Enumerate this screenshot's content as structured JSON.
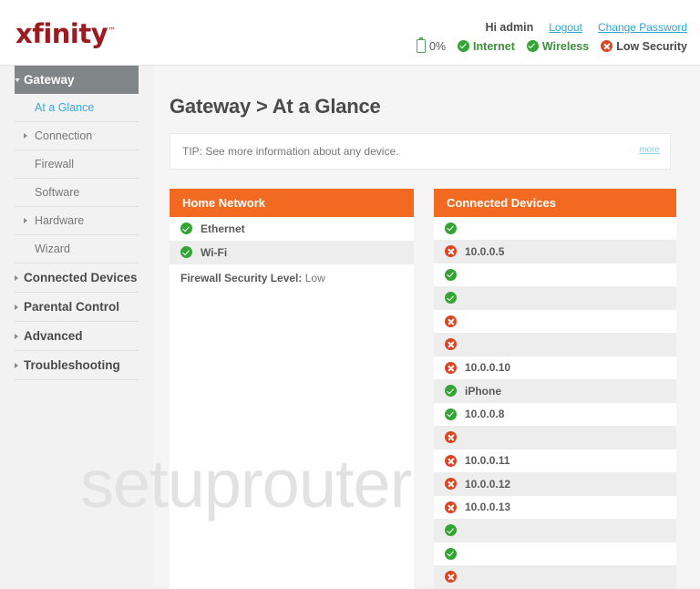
{
  "header": {
    "logo": "xfinity",
    "logo_tm": "™",
    "greeting": "Hi admin",
    "logout_label": "Logout",
    "change_password_label": "Change Password",
    "battery_percent": "0%",
    "statuses": [
      {
        "label": "Internet",
        "icon": "check-circle-icon",
        "state": "ok"
      },
      {
        "label": "Wireless",
        "icon": "check-circle-icon",
        "state": "ok"
      },
      {
        "label": "Low Security",
        "icon": "x-circle-icon",
        "state": "bad"
      }
    ]
  },
  "sidebar": {
    "items": [
      {
        "label": "Gateway",
        "type": "top",
        "caret": "down",
        "active": true
      },
      {
        "label": "At a Glance",
        "type": "sub",
        "caret": "none",
        "current": true
      },
      {
        "label": "Connection",
        "type": "sub",
        "caret": "right"
      },
      {
        "label": "Firewall",
        "type": "sub",
        "caret": "none"
      },
      {
        "label": "Software",
        "type": "sub",
        "caret": "none"
      },
      {
        "label": "Hardware",
        "type": "sub",
        "caret": "right"
      },
      {
        "label": "Wizard",
        "type": "sub",
        "caret": "none"
      },
      {
        "label": "Connected Devices",
        "type": "top",
        "caret": "right"
      },
      {
        "label": "Parental Control",
        "type": "top",
        "caret": "right"
      },
      {
        "label": "Advanced",
        "type": "top",
        "caret": "right"
      },
      {
        "label": "Troubleshooting",
        "type": "top",
        "caret": "right"
      }
    ]
  },
  "main": {
    "page_title": "Gateway > At a Glance",
    "tip": {
      "text": "TIP: See more information about any device.",
      "more_label": "more"
    },
    "home_network": {
      "title": "Home Network",
      "rows": [
        {
          "label": "Ethernet",
          "state": "ok"
        },
        {
          "label": "Wi-Fi",
          "state": "ok"
        }
      ],
      "firewall_label": "Firewall Security Level:",
      "firewall_value": "Low"
    },
    "connected_devices": {
      "title": "Connected Devices",
      "rows": [
        {
          "label": "",
          "state": "ok"
        },
        {
          "label": "10.0.0.5",
          "state": "bad"
        },
        {
          "label": "",
          "state": "ok"
        },
        {
          "label": "",
          "state": "ok"
        },
        {
          "label": "",
          "state": "bad"
        },
        {
          "label": "",
          "state": "bad"
        },
        {
          "label": "10.0.0.10",
          "state": "bad"
        },
        {
          "label": "iPhone",
          "state": "ok"
        },
        {
          "label": "10.0.0.8",
          "state": "ok"
        },
        {
          "label": "",
          "state": "bad"
        },
        {
          "label": "10.0.0.11",
          "state": "bad"
        },
        {
          "label": "10.0.0.12",
          "state": "bad"
        },
        {
          "label": "10.0.0.13",
          "state": "bad"
        },
        {
          "label": "",
          "state": "ok"
        },
        {
          "label": "",
          "state": "ok"
        },
        {
          "label": "",
          "state": "bad"
        }
      ]
    }
  },
  "watermark": "setuprouter",
  "colors": {
    "brand_orange": "#f26a21",
    "logo_red": "#9b1b21",
    "link_blue": "#2ea3d6",
    "ok_green": "#35a435",
    "bad_red": "#dd4422",
    "active_nav_gray": "#808588"
  }
}
